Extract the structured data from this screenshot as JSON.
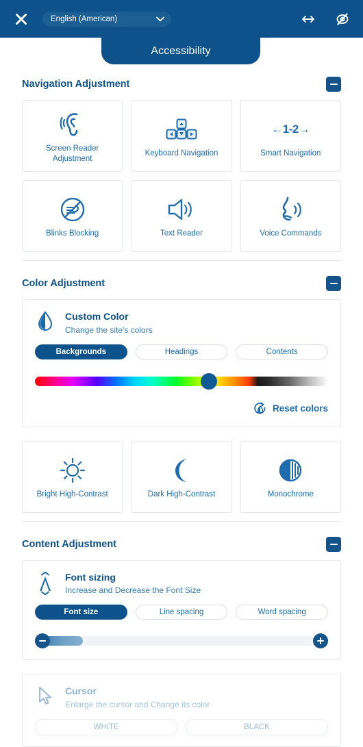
{
  "header": {
    "close_icon": "close-icon",
    "language": {
      "selected": "English (American)",
      "options": [
        "English (American)"
      ]
    },
    "resize_icon": "horizontal-resize-icon",
    "hide_icon": "eye-off-icon"
  },
  "tab": {
    "label": "Accessibility"
  },
  "sections": [
    {
      "title": "Navigation Adjustment",
      "collapse_label": "−",
      "cards": [
        {
          "label": "Screen Reader Adjustment",
          "icon": "ear-icon"
        },
        {
          "label": "Keyboard Navigation",
          "icon": "arrow-keys-icon"
        },
        {
          "label": "Smart Navigation",
          "icon": "smart-nav-icon",
          "text": "←1-2→"
        },
        {
          "label": "Blinks Blocking",
          "icon": "blink-block-icon"
        },
        {
          "label": "Text Reader",
          "icon": "speaker-icon"
        },
        {
          "label": "Voice Commands",
          "icon": "voice-icon"
        }
      ]
    },
    {
      "title": "Color Adjustment",
      "collapse_label": "−",
      "panel": {
        "icon": "droplet-icon",
        "title": "Custom Color",
        "subtitle": "Change the site's colors",
        "pills": [
          {
            "label": "Backgrounds",
            "active": true
          },
          {
            "label": "Headings",
            "active": false
          },
          {
            "label": "Contents",
            "active": false
          }
        ],
        "slider": {
          "knob_color": "#125a94",
          "knob_position_pct": 53
        },
        "reset": {
          "label": "Reset colors",
          "icon": "reset-droplet-icon"
        }
      },
      "cards": [
        {
          "label": "Bright High-Contrast",
          "icon": "sun-icon"
        },
        {
          "label": "Dark High-Contrast",
          "icon": "moon-icon"
        },
        {
          "label": "Monochrome",
          "icon": "monochrome-icon"
        }
      ]
    },
    {
      "title": "Content Adjustment",
      "collapse_label": "−",
      "panel": {
        "icon": "font-size-icon",
        "title": "Font sizing",
        "subtitle": "Increase and Decrease the Font Size",
        "pills": [
          {
            "label": "Font size",
            "active": true
          },
          {
            "label": "Line spacing",
            "active": false
          },
          {
            "label": "Word spacing",
            "active": false
          }
        ],
        "stepper": {
          "minus_icon": "minus-icon",
          "plus_icon": "plus-icon",
          "fill_pct": 17
        }
      },
      "panel2": {
        "icon": "cursor-icon",
        "title": "Cursor",
        "subtitle": "Enlarge the cursor and Change its color",
        "pills": [
          {
            "label": "WHITE",
            "active": false
          },
          {
            "label": "BLACK",
            "active": false
          }
        ]
      }
    }
  ],
  "colors": {
    "header_blue": "#0d528b",
    "accent_blue": "#1d6cb0",
    "card_border": "#e4e6ea",
    "muted_blue": "#8fb4d4"
  }
}
